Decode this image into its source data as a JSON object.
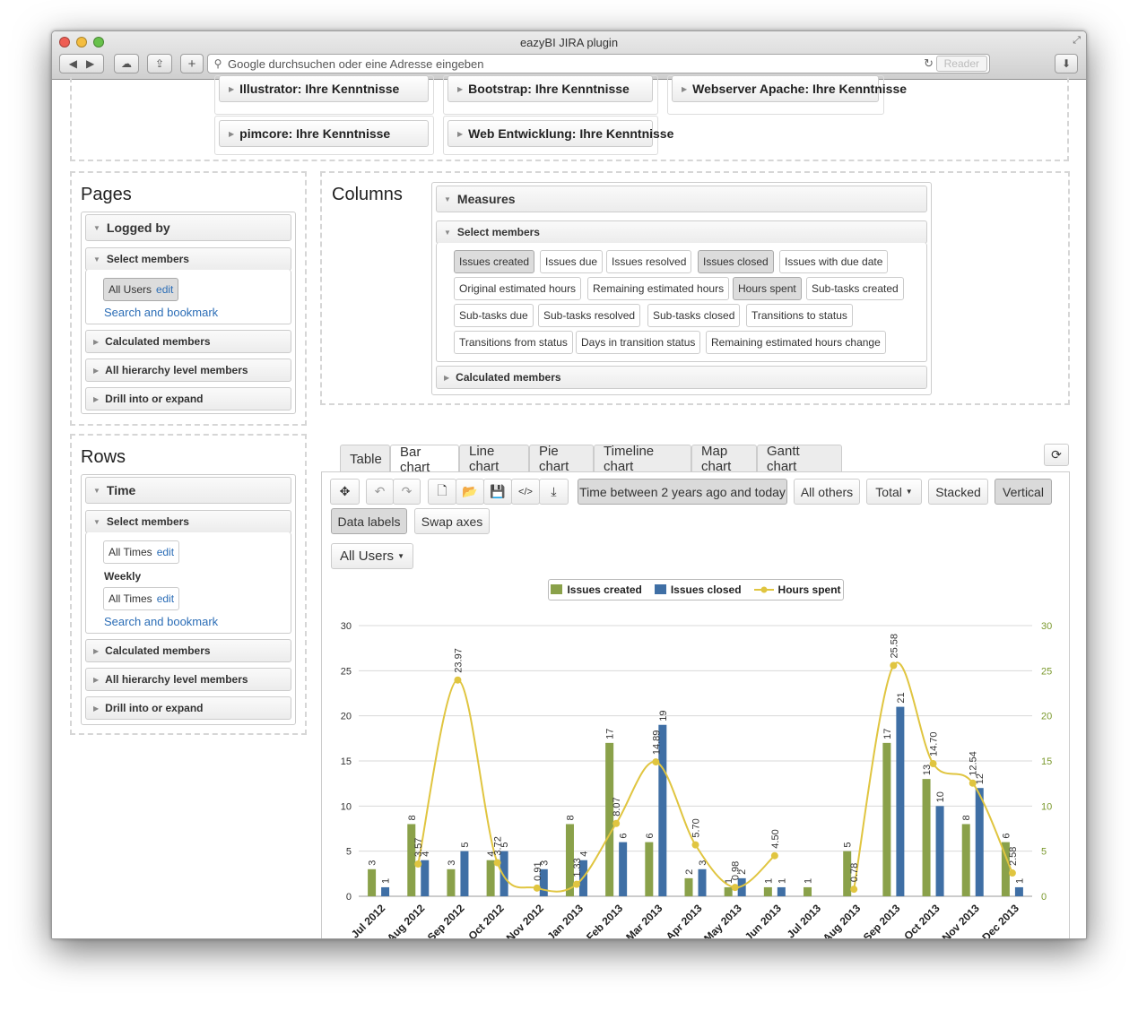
{
  "browser": {
    "title": "eazyBI JIRA plugin",
    "address_placeholder": "Google durchsuchen oder eine Adresse eingeben",
    "reader_label": "Reader"
  },
  "top_dimensions": [
    "Illustrator: Ihre Kenntnisse",
    "Bootstrap: Ihre Kenntnisse",
    "Webserver Apache: Ihre Kenntnisse",
    "pimcore: Ihre Kenntnisse",
    "Web Entwicklung: Ihre Kenntnisse"
  ],
  "pages": {
    "title": "Pages",
    "dimension": "Logged by",
    "select_members": "Select members",
    "member": "All Users",
    "edit": "edit",
    "search": "Search and bookmark",
    "calculated": "Calculated members",
    "hierarchy": "All hierarchy level members",
    "drill": "Drill into or expand"
  },
  "rows": {
    "title": "Rows",
    "dimension": "Time",
    "select_members": "Select members",
    "member1": "All Times",
    "level": "Weekly",
    "member2": "All Times",
    "edit": "edit",
    "search": "Search and bookmark",
    "calculated": "Calculated members",
    "hierarchy": "All hierarchy level members",
    "drill": "Drill into or expand"
  },
  "columns": {
    "title": "Columns",
    "dimension": "Measures",
    "select_members": "Select members",
    "calculated": "Calculated members",
    "members": [
      {
        "label": "Issues created",
        "selected": true
      },
      {
        "label": "Issues due",
        "selected": false
      },
      {
        "label": "Issues resolved",
        "selected": false
      },
      {
        "label": "Issues closed",
        "selected": true
      },
      {
        "label": "Issues with due date",
        "selected": false
      },
      {
        "label": "Original estimated hours",
        "selected": false
      },
      {
        "label": "Remaining estimated hours",
        "selected": false
      },
      {
        "label": "Hours spent",
        "selected": true
      },
      {
        "label": "Sub-tasks created",
        "selected": false
      },
      {
        "label": "Sub-tasks due",
        "selected": false
      },
      {
        "label": "Sub-tasks resolved",
        "selected": false
      },
      {
        "label": "Sub-tasks closed",
        "selected": false
      },
      {
        "label": "Transitions to status",
        "selected": false
      },
      {
        "label": "Transitions from status",
        "selected": false
      },
      {
        "label": "Days in transition status",
        "selected": false
      },
      {
        "label": "Remaining estimated hours change",
        "selected": false
      }
    ]
  },
  "tabs": [
    "Table",
    "Bar chart",
    "Line chart",
    "Pie chart",
    "Timeline chart",
    "Map chart",
    "Gantt chart"
  ],
  "active_tab": "Bar chart",
  "toolbar": {
    "time_filter": "Time between 2 years ago and today",
    "all_others": "All others",
    "total": "Total",
    "stacked": "Stacked",
    "vertical": "Vertical",
    "data_labels": "Data labels",
    "swap_axes": "Swap axes",
    "page_select": "All Users"
  },
  "colors": {
    "issues_created": "#8aa14a",
    "issues_closed": "#3f6fa5",
    "hours_spent": "#e0c540"
  },
  "chart_data": {
    "type": "bar",
    "categories": [
      "Jul 2012",
      "Aug 2012",
      "Sep 2012",
      "Oct 2012",
      "Nov 2012",
      "Jan 2013",
      "Feb 2013",
      "Mar 2013",
      "Apr 2013",
      "May 2013",
      "Jun 2013",
      "Jul 2013",
      "Aug 2013",
      "Sep 2013",
      "Oct 2013",
      "Nov 2013",
      "Dec 2013"
    ],
    "ylim": [
      0,
      30
    ],
    "y_ticks": [
      0,
      5,
      10,
      15,
      20,
      25,
      30
    ],
    "legend_position": "top-center",
    "grid": true,
    "series": [
      {
        "name": "Issues created",
        "type": "bar",
        "values": [
          3,
          8,
          3,
          4,
          null,
          8,
          17,
          6,
          2,
          1,
          1,
          1,
          5,
          17,
          13,
          8,
          6
        ]
      },
      {
        "name": "Issues closed",
        "type": "bar",
        "values": [
          1,
          4,
          5,
          5,
          3,
          4,
          6,
          19,
          3,
          2,
          1,
          null,
          null,
          21,
          10,
          12,
          1
        ]
      },
      {
        "name": "Hours spent",
        "type": "line",
        "values": [
          null,
          3.57,
          23.97,
          3.72,
          0.91,
          1.33,
          8.07,
          14.89,
          5.7,
          0.98,
          4.5,
          null,
          0.78,
          25.58,
          14.7,
          12.54,
          2.58
        ]
      }
    ]
  }
}
